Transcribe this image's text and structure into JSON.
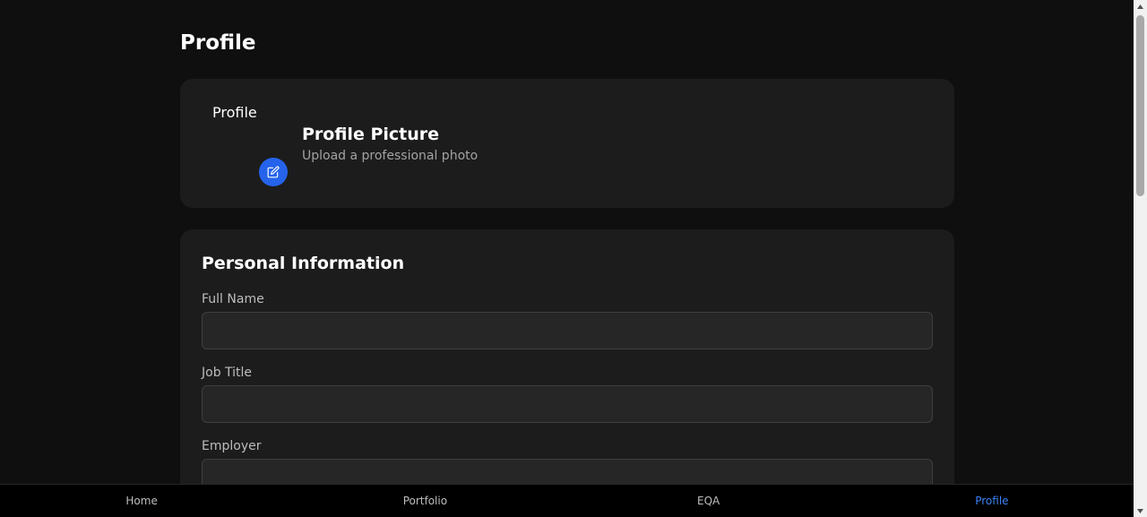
{
  "page": {
    "title": "Profile"
  },
  "profile_picture": {
    "avatar_alt": "Profile",
    "title": "Profile Picture",
    "subtitle": "Upload a professional photo",
    "edit_icon": "edit-pencil-icon"
  },
  "personal_info": {
    "title": "Personal Information",
    "fields": [
      {
        "label": "Full Name",
        "value": "",
        "placeholder": ""
      },
      {
        "label": "Job Title",
        "value": "",
        "placeholder": ""
      },
      {
        "label": "Employer",
        "value": "",
        "placeholder": ""
      }
    ]
  },
  "nav": {
    "items": [
      {
        "label": "Home"
      },
      {
        "label": "Portfolio"
      },
      {
        "label": "EQA"
      },
      {
        "label": "Profile"
      }
    ],
    "active": "Profile"
  },
  "colors": {
    "background": "#0f0f0f",
    "card": "#1c1c1c",
    "accent": "#2563eb",
    "nav_active": "#3b82f6"
  }
}
